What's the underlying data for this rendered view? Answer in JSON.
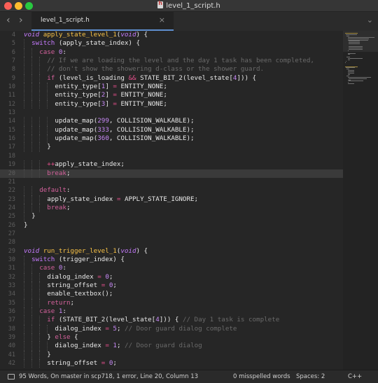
{
  "window": {
    "title": "level_1_script.h"
  },
  "tabs": [
    {
      "label": "level_1_script.h",
      "close": "×"
    }
  ],
  "nav": {
    "back": "‹",
    "forward": "›",
    "menu": "⌄"
  },
  "editor": {
    "active_line": 20,
    "lines": [
      {
        "n": "4",
        "indent": 0,
        "tokens": [
          [
            "ty",
            "void"
          ],
          [
            "st",
            " "
          ],
          [
            "fn",
            "apply_state_level_1"
          ],
          [
            "st",
            "("
          ],
          [
            "ty",
            "void"
          ],
          [
            "st",
            ") {"
          ]
        ]
      },
      {
        "n": "5",
        "indent": 1,
        "tokens": [
          [
            "kw",
            "switch"
          ],
          [
            "st",
            " (apply_state_index) {"
          ]
        ]
      },
      {
        "n": "6",
        "indent": 2,
        "tokens": [
          [
            "k",
            "case"
          ],
          [
            "st",
            " "
          ],
          [
            "num",
            "0"
          ],
          [
            "st",
            ":"
          ]
        ]
      },
      {
        "n": "7",
        "indent": 3,
        "tokens": [
          [
            "cm",
            "// If we are loading the level and the day 1 task has been completed,"
          ]
        ]
      },
      {
        "n": "8",
        "indent": 3,
        "tokens": [
          [
            "cm",
            "// don't show the showering d-class or the shower guard."
          ]
        ]
      },
      {
        "n": "9",
        "indent": 3,
        "tokens": [
          [
            "k",
            "if"
          ],
          [
            "st",
            " (level_is_loading "
          ],
          [
            "op",
            "&&"
          ],
          [
            "st",
            " STATE_BIT_2(level_state["
          ],
          [
            "num",
            "4"
          ],
          [
            "st",
            "])) {"
          ]
        ]
      },
      {
        "n": "10",
        "indent": 4,
        "tokens": [
          [
            "st",
            "entity_type["
          ],
          [
            "num",
            "1"
          ],
          [
            "st",
            "] "
          ],
          [
            "op",
            "="
          ],
          [
            "st",
            " ENTITY_NONE;"
          ]
        ]
      },
      {
        "n": "11",
        "indent": 4,
        "tokens": [
          [
            "st",
            "entity_type["
          ],
          [
            "num",
            "2"
          ],
          [
            "st",
            "] "
          ],
          [
            "op",
            "="
          ],
          [
            "st",
            " ENTITY_NONE;"
          ]
        ]
      },
      {
        "n": "12",
        "indent": 4,
        "tokens": [
          [
            "st",
            "entity_type["
          ],
          [
            "num",
            "3"
          ],
          [
            "st",
            "] "
          ],
          [
            "op",
            "="
          ],
          [
            "st",
            " ENTITY_NONE;"
          ]
        ]
      },
      {
        "n": "13",
        "indent": 0,
        "tokens": []
      },
      {
        "n": "14",
        "indent": 4,
        "tokens": [
          [
            "st",
            "update_map("
          ],
          [
            "num",
            "299"
          ],
          [
            "st",
            ", COLLISION_WALKABLE);"
          ]
        ]
      },
      {
        "n": "15",
        "indent": 4,
        "tokens": [
          [
            "st",
            "update_map("
          ],
          [
            "num",
            "333"
          ],
          [
            "st",
            ", COLLISION_WALKABLE);"
          ]
        ]
      },
      {
        "n": "16",
        "indent": 4,
        "tokens": [
          [
            "st",
            "update_map("
          ],
          [
            "num",
            "360"
          ],
          [
            "st",
            ", COLLISION_WALKABLE);"
          ]
        ]
      },
      {
        "n": "17",
        "indent": 3,
        "tokens": [
          [
            "st",
            "}"
          ]
        ]
      },
      {
        "n": "18",
        "indent": 0,
        "tokens": []
      },
      {
        "n": "19",
        "indent": 3,
        "tokens": [
          [
            "op",
            "++"
          ],
          [
            "st",
            "apply_state_index;"
          ]
        ]
      },
      {
        "n": "20",
        "indent": 3,
        "tokens": [
          [
            "k",
            "break"
          ],
          [
            "st",
            ";"
          ]
        ]
      },
      {
        "n": "21",
        "indent": 0,
        "tokens": []
      },
      {
        "n": "22",
        "indent": 2,
        "tokens": [
          [
            "k",
            "default"
          ],
          [
            "st",
            ":"
          ]
        ]
      },
      {
        "n": "23",
        "indent": 3,
        "tokens": [
          [
            "st",
            "apply_state_index "
          ],
          [
            "op",
            "="
          ],
          [
            "st",
            " APPLY_STATE_IGNORE;"
          ]
        ]
      },
      {
        "n": "24",
        "indent": 3,
        "tokens": [
          [
            "k",
            "break"
          ],
          [
            "st",
            ";"
          ]
        ]
      },
      {
        "n": "25",
        "indent": 1,
        "tokens": [
          [
            "st",
            "}"
          ]
        ]
      },
      {
        "n": "26",
        "indent": 0,
        "tokens": [
          [
            "st",
            "}"
          ]
        ]
      },
      {
        "n": "27",
        "indent": 0,
        "tokens": []
      },
      {
        "n": "28",
        "indent": 0,
        "tokens": []
      },
      {
        "n": "29",
        "indent": 0,
        "tokens": [
          [
            "ty",
            "void"
          ],
          [
            "st",
            " "
          ],
          [
            "fn",
            "run_trigger_level_1"
          ],
          [
            "st",
            "("
          ],
          [
            "ty",
            "void"
          ],
          [
            "st",
            ") {"
          ]
        ]
      },
      {
        "n": "30",
        "indent": 1,
        "tokens": [
          [
            "kw",
            "switch"
          ],
          [
            "st",
            " (trigger_index) {"
          ]
        ]
      },
      {
        "n": "31",
        "indent": 2,
        "tokens": [
          [
            "k",
            "case"
          ],
          [
            "st",
            " "
          ],
          [
            "num",
            "0"
          ],
          [
            "st",
            ":"
          ]
        ]
      },
      {
        "n": "32",
        "indent": 3,
        "tokens": [
          [
            "st",
            "dialog_index "
          ],
          [
            "op",
            "="
          ],
          [
            "st",
            " "
          ],
          [
            "num",
            "0"
          ],
          [
            "st",
            ";"
          ]
        ]
      },
      {
        "n": "33",
        "indent": 3,
        "tokens": [
          [
            "st",
            "string_offset "
          ],
          [
            "op",
            "="
          ],
          [
            "st",
            " "
          ],
          [
            "num",
            "0"
          ],
          [
            "st",
            ";"
          ]
        ]
      },
      {
        "n": "34",
        "indent": 3,
        "tokens": [
          [
            "st",
            "enable_textbox();"
          ]
        ]
      },
      {
        "n": "35",
        "indent": 3,
        "tokens": [
          [
            "k",
            "return"
          ],
          [
            "st",
            ";"
          ]
        ]
      },
      {
        "n": "36",
        "indent": 2,
        "tokens": [
          [
            "k",
            "case"
          ],
          [
            "st",
            " "
          ],
          [
            "num",
            "1"
          ],
          [
            "st",
            ":"
          ]
        ]
      },
      {
        "n": "37",
        "indent": 3,
        "tokens": [
          [
            "k",
            "if"
          ],
          [
            "st",
            " (STATE_BIT_2(level_state["
          ],
          [
            "num",
            "4"
          ],
          [
            "st",
            "])) { "
          ],
          [
            "cm",
            "// Day 1 task is complete"
          ]
        ]
      },
      {
        "n": "38",
        "indent": 4,
        "tokens": [
          [
            "st",
            "dialog_index "
          ],
          [
            "op",
            "="
          ],
          [
            "st",
            " "
          ],
          [
            "num",
            "5"
          ],
          [
            "st",
            "; "
          ],
          [
            "cm",
            "// Door guard dialog complete"
          ]
        ]
      },
      {
        "n": "39",
        "indent": 3,
        "tokens": [
          [
            "st",
            "} "
          ],
          [
            "k",
            "else"
          ],
          [
            "st",
            " {"
          ]
        ]
      },
      {
        "n": "40",
        "indent": 4,
        "tokens": [
          [
            "st",
            "dialog_index "
          ],
          [
            "op",
            "="
          ],
          [
            "st",
            " "
          ],
          [
            "num",
            "1"
          ],
          [
            "st",
            "; "
          ],
          [
            "cm",
            "// Door guard dialog"
          ]
        ]
      },
      {
        "n": "41",
        "indent": 3,
        "tokens": [
          [
            "st",
            "}"
          ]
        ]
      },
      {
        "n": "42",
        "indent": 3,
        "tokens": [
          [
            "st",
            "string_offset "
          ],
          [
            "op",
            "="
          ],
          [
            "st",
            " "
          ],
          [
            "num",
            "0"
          ],
          [
            "st",
            ";"
          ]
        ]
      }
    ]
  },
  "status": {
    "left": "95 Words, On master in scp718, 1 error, Line 20, Column 13",
    "spelling": "0 misspelled words",
    "spaces": "Spaces: 2",
    "language": "C++"
  },
  "colors": {
    "keyword": "#d3619b",
    "type": "#c67bff",
    "function": "#f8c246",
    "number": "#c889f7",
    "comment": "#6a6a6a",
    "operator": "#e6508c",
    "tab_accent": "#5f8fd0"
  }
}
